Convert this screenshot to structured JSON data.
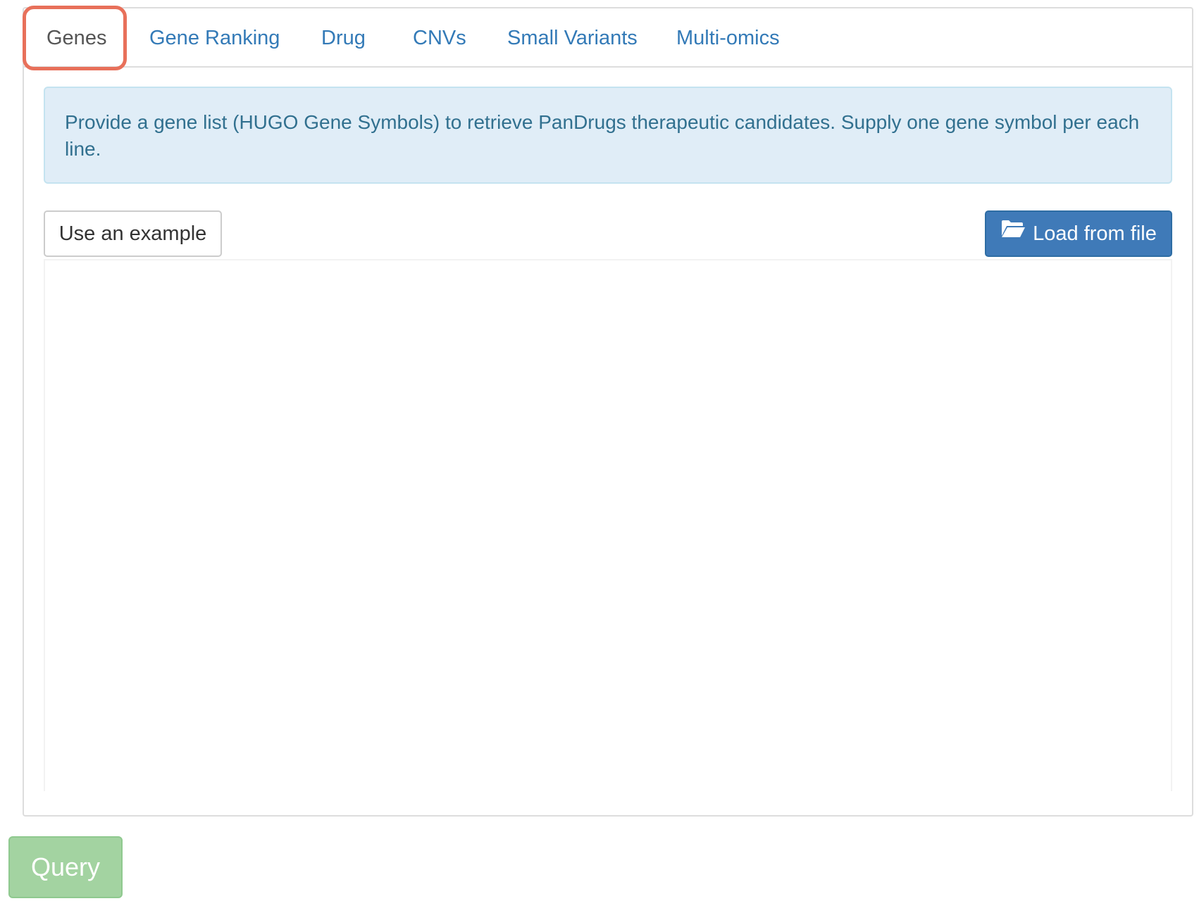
{
  "tabs": [
    {
      "label": "Genes",
      "active": true
    },
    {
      "label": "Gene Ranking",
      "active": false
    },
    {
      "label": "Drug",
      "active": false
    },
    {
      "label": "CNVs",
      "active": false
    },
    {
      "label": "Small Variants",
      "active": false
    },
    {
      "label": "Multi-omics",
      "active": false
    }
  ],
  "info": {
    "text": "Provide a gene list (HUGO Gene Symbols) to retrieve PanDrugs therapeutic candidates. Supply one gene symbol per each line."
  },
  "buttons": {
    "example_label": "Use an example",
    "load_label": "Load from file",
    "load_icon": "folder-open-icon",
    "query_label": "Query"
  },
  "gene_input": {
    "value": "",
    "placeholder": ""
  },
  "colors": {
    "link": "#337ab7",
    "active_tab": "#555555",
    "highlight": "#e8705a",
    "info_bg": "#e0edf7",
    "info_text": "#31708f",
    "primary": "#3f7ab8",
    "query_disabled": "#a3d3a1"
  }
}
